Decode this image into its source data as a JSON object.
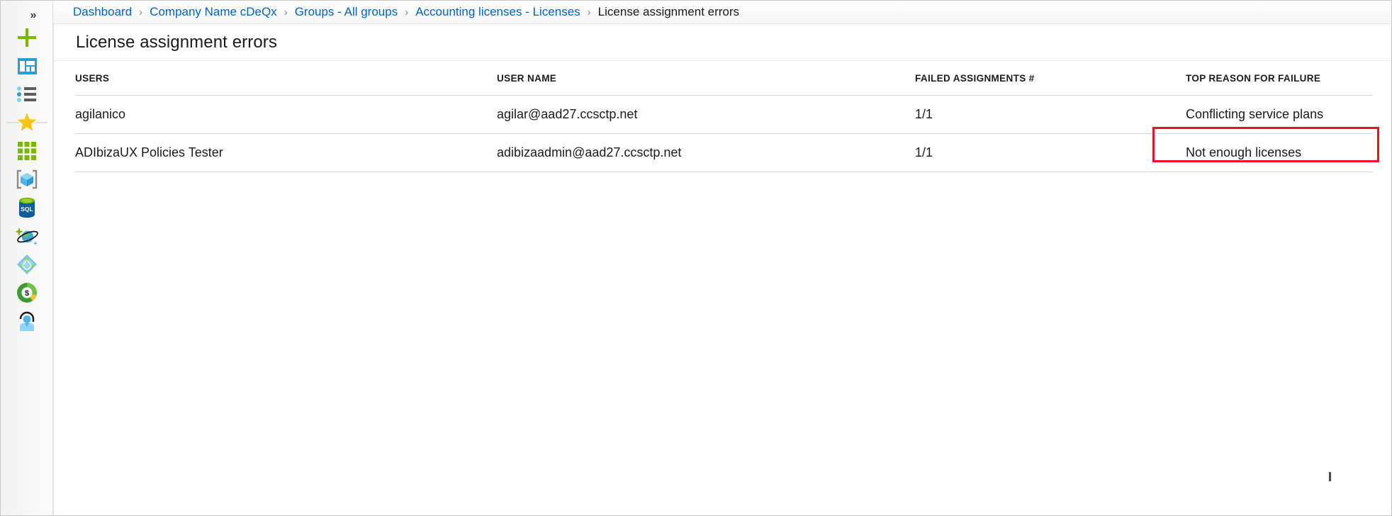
{
  "sidebar": {
    "collapse_button": {
      "label": "»",
      "name": "collapse-sidebar-button"
    },
    "items": [
      {
        "name": "create-a-resource-icon",
        "icon": "plus-icon",
        "label": "Create a resource"
      },
      {
        "name": "dashboard-icon",
        "icon": "dashboard-icon",
        "label": "Dashboard"
      },
      {
        "name": "all-resources-icon",
        "icon": "list-icon",
        "label": "All resources"
      },
      {
        "name": "favorites-icon",
        "icon": "star-icon",
        "label": "Favorites"
      },
      {
        "name": "all-services-icon",
        "icon": "grid-icon",
        "label": "All services"
      },
      {
        "name": "resource-groups-icon",
        "icon": "cube-icon",
        "label": "Resource groups"
      },
      {
        "name": "sql-databases-icon",
        "icon": "sql-database-icon",
        "label": "SQL databases"
      },
      {
        "name": "cosmos-db-icon",
        "icon": "planet-icon",
        "label": "Azure Cosmos DB"
      },
      {
        "name": "azure-active-directory-icon",
        "icon": "diamond-icon",
        "label": "Azure Active Directory"
      },
      {
        "name": "cost-management-icon",
        "icon": "dollar-pie-icon",
        "label": "Cost Management + Billing"
      },
      {
        "name": "help-and-support-icon",
        "icon": "person-headset-icon",
        "label": "Help + support"
      }
    ]
  },
  "breadcrumb": {
    "separator": "›",
    "items": [
      {
        "label": "Dashboard",
        "current": false
      },
      {
        "label": "Company Name cDeQx",
        "current": false
      },
      {
        "label": "Groups - All groups",
        "current": false
      },
      {
        "label": "Accounting licenses - Licenses",
        "current": false
      },
      {
        "label": "License assignment errors",
        "current": true
      }
    ]
  },
  "blade": {
    "title": "License assignment errors"
  },
  "grid": {
    "columns": [
      {
        "key": "users",
        "header": "USERS"
      },
      {
        "key": "user_name",
        "header": "USER NAME"
      },
      {
        "key": "failed_assignments",
        "header": "FAILED ASSIGNMENTS #"
      },
      {
        "key": "top_reason",
        "header": "TOP REASON FOR FAILURE"
      }
    ],
    "rows": [
      {
        "users": "agilanico",
        "user_name": "agilar@aad27.ccsctp.net",
        "failed_assignments": "1/1",
        "top_reason": "Conflicting service plans",
        "highlighted": true
      },
      {
        "users": "ADIbizaUX Policies Tester",
        "user_name": "adibizaadmin@aad27.ccsctp.net",
        "failed_assignments": "1/1",
        "top_reason": "Not enough licenses",
        "highlighted": false
      }
    ]
  },
  "colors": {
    "link": "#0063c7",
    "highlight_border": "#e81123",
    "accent_green": "#7ab800",
    "accent_blue": "#2e9bd6",
    "scrollbar_thumb": "#f2cf9e"
  }
}
